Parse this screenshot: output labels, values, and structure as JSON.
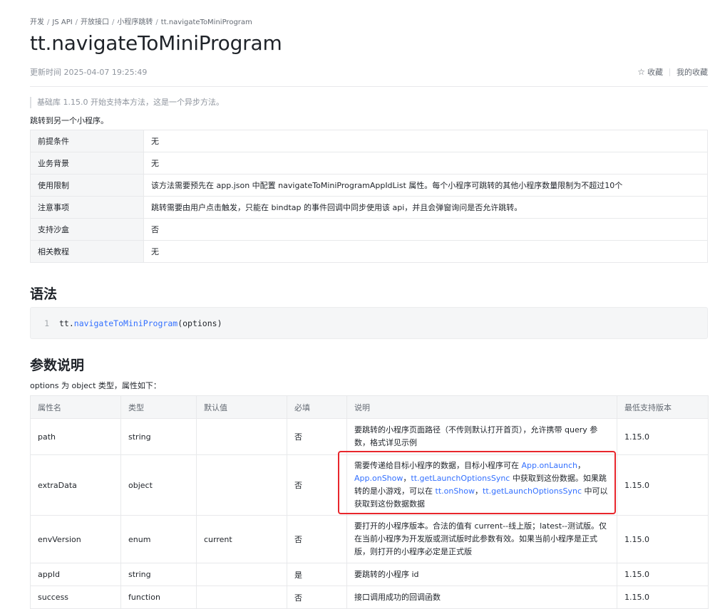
{
  "breadcrumb": {
    "items": [
      "开发",
      "JS API",
      "开放接口",
      "小程序跳转",
      "tt.navigateToMiniProgram"
    ]
  },
  "page": {
    "title": "tt.navigateToMiniProgram",
    "update_time": "更新时间 2025-04-07 19:25:49",
    "favorite_label": "收藏",
    "my_favorites_label": "我的收藏",
    "notice": "基础库 1.15.0 开始支持本方法，这是一个异步方法。",
    "description": "跳转到另一个小程序。"
  },
  "info_table": [
    {
      "key": "前提条件",
      "value": "无"
    },
    {
      "key": "业务背景",
      "value": "无"
    },
    {
      "key": "使用限制",
      "value": "该方法需要预先在 app.json 中配置 navigateToMiniProgramAppIdList 属性。每个小程序可跳转的其他小程序数量限制为不超过10个"
    },
    {
      "key": "注意事项",
      "value": "跳转需要由用户点击触发，只能在 bindtap 的事件回调中同步使用该 api，并且会弹窗询问是否允许跳转。"
    },
    {
      "key": "支持沙盒",
      "value": "否"
    },
    {
      "key": "相关教程",
      "value": "无"
    }
  ],
  "syntax": {
    "heading": "语法",
    "line_number": "1",
    "code_object": "tt.",
    "code_method": "navigateToMiniProgram",
    "code_args": "(options)"
  },
  "params": {
    "heading": "参数说明",
    "note": "options 为 object 类型，属性如下：",
    "headers": [
      "属性名",
      "类型",
      "默认值",
      "必填",
      "说明",
      "最低支持版本"
    ],
    "rows": [
      {
        "name": "path",
        "type": "string",
        "default": "",
        "required": "否",
        "desc": "要跳转的小程序页面路径（不传则默认打开首页），允许携带 query 参数，格式详见示例",
        "version": "1.15.0"
      },
      {
        "name": "extraData",
        "type": "object",
        "default": "",
        "required": "否",
        "desc_1": "需要传递给目标小程序的数据，目标小程序可在 ",
        "link_1": "App.onLaunch",
        "desc_2": "，",
        "link_2": "App.onShow",
        "desc_3": "，",
        "link_3": "tt.getLaunchOptionsSync",
        "desc_4": " 中获取到这份数据。如果跳转的是小游戏，可以在 ",
        "link_4": "tt.onShow",
        "desc_5": "，",
        "link_5": "tt.getLaunchOptionsSync",
        "desc_6": " 中可以获取到这份数据数据",
        "version": "1.15.0"
      },
      {
        "name": "envVersion",
        "type": "enum",
        "default": "current",
        "required": "否",
        "desc": "要打开的小程序版本。合法的值有 current--线上版；latest--测试版。仅在当前小程序为开发版或测试版时此参数有效。如果当前小程序是正式版，则打开的小程序必定是正式版",
        "version": "1.15.0"
      },
      {
        "name": "appId",
        "type": "string",
        "default": "",
        "required": "是",
        "desc": "要跳转的小程序 id",
        "version": "1.15.0"
      },
      {
        "name": "success",
        "type": "function",
        "default": "",
        "required": "否",
        "desc": "接口调用成功的回调函数",
        "version": "1.15.0"
      }
    ]
  },
  "colors": {
    "link": "#3370ff",
    "highlight": "#e8262c",
    "table_header_bg": "#f5f6f7",
    "border": "#e8e9eb"
  }
}
